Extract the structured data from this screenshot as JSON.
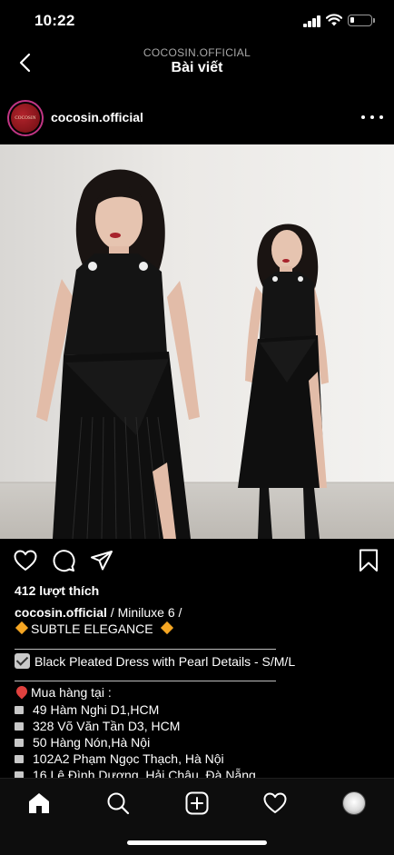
{
  "status_bar": {
    "time": "10:22"
  },
  "header": {
    "account": "COCOSIN.OFFICIAL",
    "title": "Bài viết"
  },
  "post": {
    "username": "cocosin.official",
    "avatar_text": "COCOSIN",
    "photo_icon": "two-models-black-pleated-dress-photo",
    "likes": "412 lượt thích",
    "caption": {
      "user": "cocosin.official",
      "line1": " / Miniluxe 6 /",
      "line2": "SUBTLE ELEGANCE",
      "product": "Black Pleated Dress with Pearl Details - S/M/L",
      "buy_title": "Mua hàng tại :",
      "stores": [
        "49 Hàm Nghi D1,HCM",
        "328 Võ Văn Tần D3, HCM",
        "50 Hàng Nón,Hà Nội",
        "102A2 Phạm Ngọc Thạch, Hà Nội",
        "16 Lê Đình Dương, Hải Châu, Đà Nẵng"
      ]
    }
  },
  "tab_bar": [
    "home-icon",
    "search-icon",
    "add-post-icon",
    "activity-icon",
    "profile-avatar"
  ],
  "colors": {
    "background": "#000000",
    "text": "#ffffff",
    "secondary": "#a8a8a8",
    "story_ring": "#c13584"
  }
}
